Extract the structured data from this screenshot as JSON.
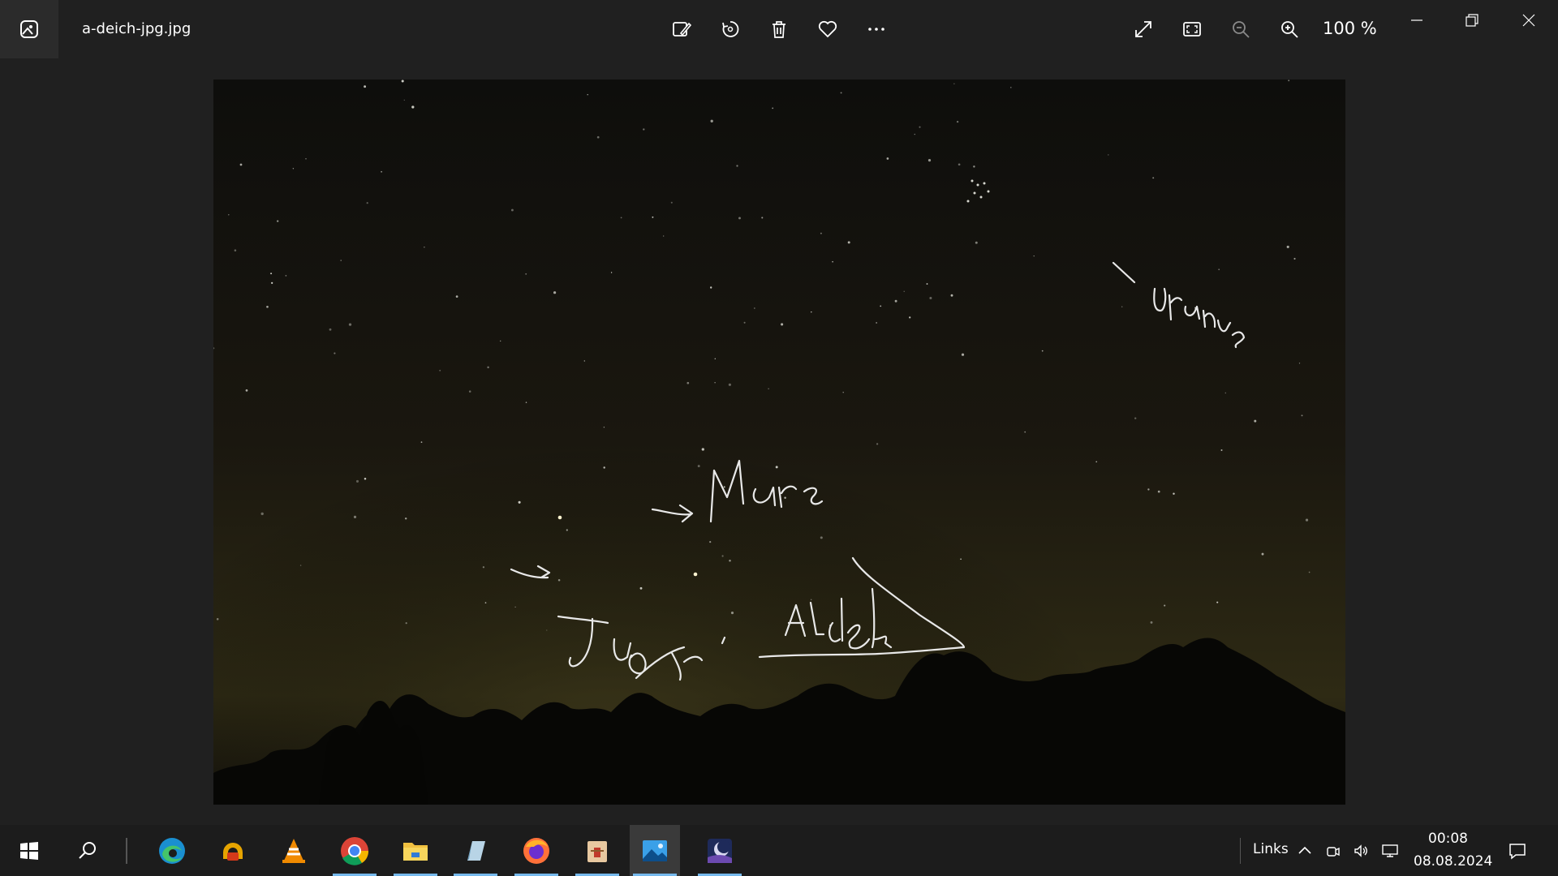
{
  "window": {
    "file_name": "a-deich-jpg.jpg",
    "zoom_level": "100 %"
  },
  "toolbar": {
    "icons": [
      "edit-image-icon",
      "rotate-icon",
      "delete-icon",
      "favorite-icon",
      "more-icon",
      "fullscreen-icon",
      "fit-window-icon",
      "zoom-out-icon",
      "zoom-in-icon"
    ]
  },
  "photo": {
    "handwritten_labels": [
      "Uranus",
      "Mars",
      "Jupiter",
      "Aldebaran"
    ]
  },
  "taskbar": {
    "apps": [
      "edge-icon",
      "winamp-icon",
      "vlc-icon",
      "chrome-icon",
      "file-explorer-icon",
      "notes-icon",
      "firefox-icon",
      "archive-icon",
      "photos-icon",
      "stellarium-icon"
    ],
    "tray_label": "Links",
    "clock_time": "00:08",
    "clock_date": "08.08.2024"
  },
  "colors": {
    "taskbar_underline": "#76b9ed",
    "sky_top": "#0e0e0c",
    "sky_horizon": "#2e2a14"
  }
}
